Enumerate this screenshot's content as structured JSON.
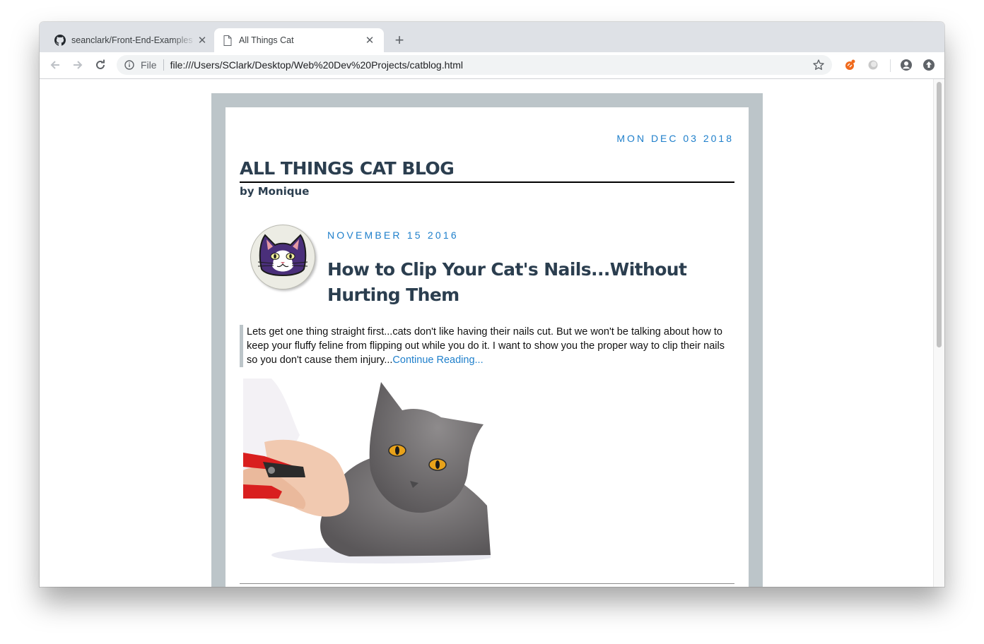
{
  "browser": {
    "tabs": [
      {
        "title": "seanclark/Front-End-Examples",
        "active": false,
        "icon": "github-icon"
      },
      {
        "title": "All Things Cat",
        "active": true,
        "icon": "page-icon"
      }
    ],
    "address": {
      "scheme_label": "File",
      "url": "file:///Users/SClark/Desktop/Web%20Dev%20Projects/catblog.html"
    },
    "colors": {
      "tabstrip": "#dee1e6",
      "omnibox": "#f1f3f4"
    }
  },
  "page": {
    "date": "MON DEC 03 2018",
    "blog_title": "ALL THINGS CAT BLOG",
    "byline": "by Monique",
    "post": {
      "date": "NOVEMBER 15 2016",
      "title": "How to Clip Your Cat's Nails...Without Hurting Them",
      "excerpt": "Lets get one thing straight first...cats don't like having their nails cut. But we won't be talking about how to keep your fluffy feline from flipping out while you do it. I want to show you the proper way to clip their nails so you don't cause them injury...",
      "read_more": "Continue Reading..."
    },
    "colors": {
      "frame": "#bcc5c9",
      "heading": "#2b3e4f",
      "accent": "#1e7fcb"
    }
  }
}
